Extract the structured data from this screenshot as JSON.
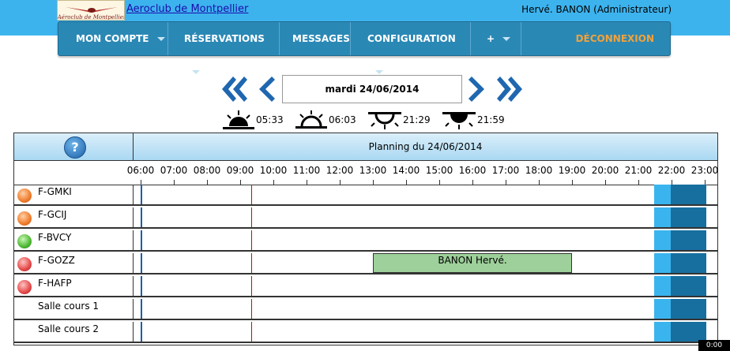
{
  "header": {
    "site_name": "Aeroclub de Montpellier",
    "logo_text": "Aéroclub de Montpellier",
    "user": "Hervé. BANON (Administrateur)"
  },
  "menu": {
    "items": [
      {
        "label": "MON COMPTE",
        "dropdown": true
      },
      {
        "label": "RÉSERVATIONS",
        "dropdown": true
      },
      {
        "label": "MESSAGES",
        "dropdown": false
      },
      {
        "label": "CONFIGURATION",
        "dropdown": true
      },
      {
        "label": "+",
        "dropdown": true
      }
    ],
    "logout": "DÉCONNEXION"
  },
  "date_nav": {
    "current_date": "mardi 24/06/2014"
  },
  "sun_times": [
    {
      "icon": "sunrise-dawn-icon",
      "time": "05:33"
    },
    {
      "icon": "sunrise-icon",
      "time": "06:03"
    },
    {
      "icon": "sunset-icon",
      "time": "21:29"
    },
    {
      "icon": "sunset-dusk-icon",
      "time": "21:59"
    }
  ],
  "planning": {
    "title": "Planning du 24/06/2014",
    "hours": [
      "06:00",
      "07:00",
      "08:00",
      "09:00",
      "10:00",
      "11:00",
      "12:00",
      "13:00",
      "14:00",
      "15:00",
      "16:00",
      "17:00",
      "18:00",
      "19:00",
      "20:00",
      "21:00",
      "22:00",
      "23:00"
    ],
    "current_time": "09:20",
    "night_start": "21:29",
    "dark_start": "21:59",
    "end_time": "23:00",
    "resources": [
      {
        "name": "F-GMKI",
        "status": "orange"
      },
      {
        "name": "F-GCIJ",
        "status": "orange"
      },
      {
        "name": "F-BVCY",
        "status": "green"
      },
      {
        "name": "F-GOZZ",
        "status": "red"
      },
      {
        "name": "F-HAFP",
        "status": "red"
      },
      {
        "name": "Salle cours 1",
        "status": "none"
      },
      {
        "name": "Salle cours 2",
        "status": "none"
      }
    ],
    "bookings": [
      {
        "row": 3,
        "label": "BANON Hervé.",
        "start": "13:00",
        "end": "19:00"
      }
    ]
  },
  "corner_badge": "0:00"
}
